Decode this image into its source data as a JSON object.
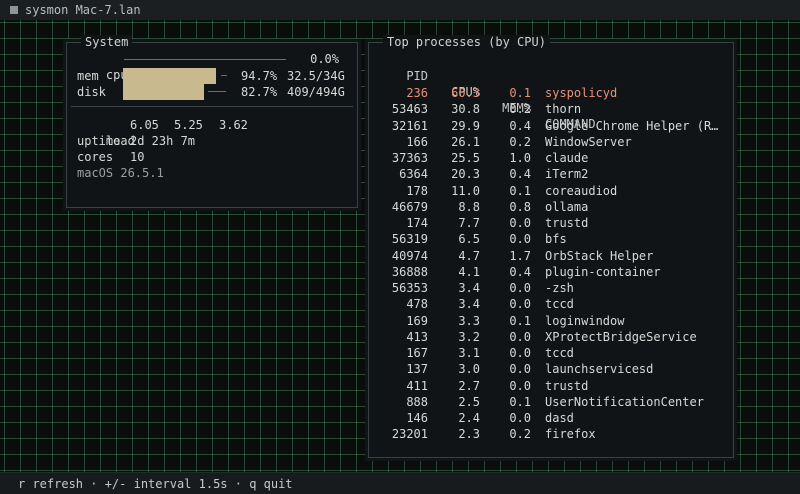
{
  "window": {
    "title": "sysmon Mac-7.lan"
  },
  "system": {
    "title": "System",
    "cpu": {
      "label": "cpu",
      "percent": "0.0%",
      "fraction": 0.0
    },
    "mem": {
      "label": "mem",
      "percent": "94.7%",
      "amount": "32.5/34G",
      "fraction": 0.947
    },
    "disk": {
      "label": "disk",
      "percent": "82.7%",
      "amount": "409/494G",
      "fraction": 0.827
    },
    "load": {
      "label": "load",
      "values": [
        "6.05",
        "5.25",
        "3.62"
      ]
    },
    "uptime": {
      "label": "uptime",
      "value": "2d 23h 7m"
    },
    "cores": {
      "label": "cores",
      "value": "10"
    },
    "os": "macOS 26.5.1",
    "colors": {
      "bar": "#c9b98f"
    }
  },
  "processes": {
    "title": "Top processes (by CPU)",
    "headers": {
      "pid": "PID",
      "cpu": "CPU%",
      "mem": "MEM%",
      "command": "COMMAND"
    },
    "highlight_color": "#e8907a",
    "rows": [
      {
        "pid": "236",
        "cpu": "60.3",
        "mem": "0.1",
        "command": "syspolicyd",
        "hot": true
      },
      {
        "pid": "53463",
        "cpu": "30.8",
        "mem": "0.2",
        "command": "thorn"
      },
      {
        "pid": "32161",
        "cpu": "29.9",
        "mem": "0.4",
        "command": "Google Chrome Helper (R…"
      },
      {
        "pid": "166",
        "cpu": "26.1",
        "mem": "0.2",
        "command": "WindowServer"
      },
      {
        "pid": "37363",
        "cpu": "25.5",
        "mem": "1.0",
        "command": "claude"
      },
      {
        "pid": "6364",
        "cpu": "20.3",
        "mem": "0.4",
        "command": "iTerm2"
      },
      {
        "pid": "178",
        "cpu": "11.0",
        "mem": "0.1",
        "command": "coreaudiod"
      },
      {
        "pid": "46679",
        "cpu": "8.8",
        "mem": "0.8",
        "command": "ollama"
      },
      {
        "pid": "174",
        "cpu": "7.7",
        "mem": "0.0",
        "command": "trustd"
      },
      {
        "pid": "56319",
        "cpu": "6.5",
        "mem": "0.0",
        "command": "bfs"
      },
      {
        "pid": "40974",
        "cpu": "4.7",
        "mem": "1.7",
        "command": "OrbStack Helper"
      },
      {
        "pid": "36888",
        "cpu": "4.1",
        "mem": "0.4",
        "command": "plugin-container"
      },
      {
        "pid": "56353",
        "cpu": "3.4",
        "mem": "0.0",
        "command": "-zsh"
      },
      {
        "pid": "478",
        "cpu": "3.4",
        "mem": "0.0",
        "command": "tccd"
      },
      {
        "pid": "169",
        "cpu": "3.3",
        "mem": "0.1",
        "command": "loginwindow"
      },
      {
        "pid": "413",
        "cpu": "3.2",
        "mem": "0.0",
        "command": "XProtectBridgeService"
      },
      {
        "pid": "167",
        "cpu": "3.1",
        "mem": "0.0",
        "command": "tccd"
      },
      {
        "pid": "137",
        "cpu": "3.0",
        "mem": "0.0",
        "command": "launchservicesd"
      },
      {
        "pid": "411",
        "cpu": "2.7",
        "mem": "0.0",
        "command": "trustd"
      },
      {
        "pid": "888",
        "cpu": "2.5",
        "mem": "0.1",
        "command": "UserNotificationCenter"
      },
      {
        "pid": "146",
        "cpu": "2.4",
        "mem": "0.0",
        "command": "dasd"
      },
      {
        "pid": "23201",
        "cpu": "2.3",
        "mem": "0.2",
        "command": "firefox"
      }
    ]
  },
  "statusbar": {
    "text": "r refresh · +/- interval 1.5s · q quit"
  }
}
